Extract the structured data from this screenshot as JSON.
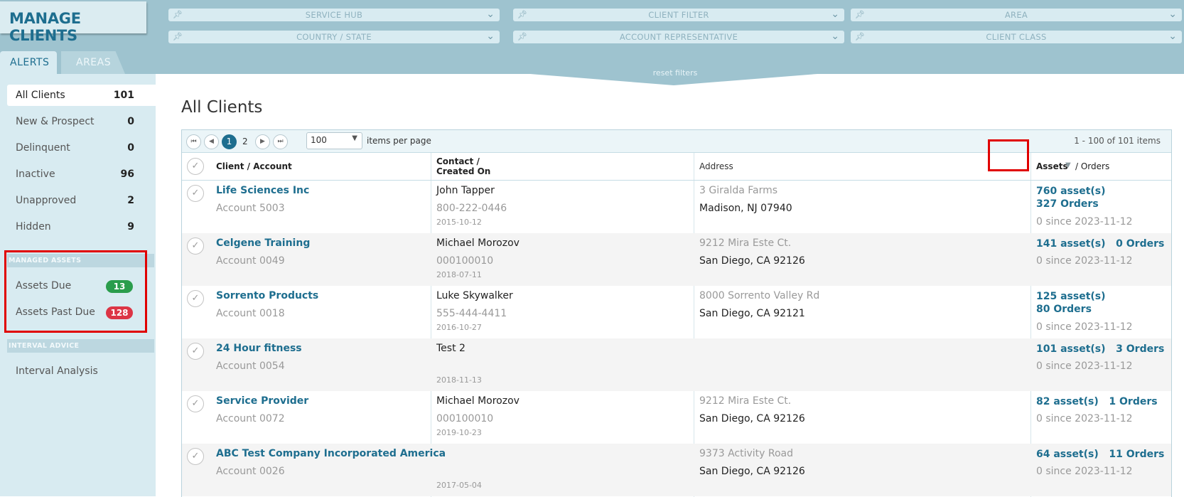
{
  "header": {
    "title": "MANAGE CLIENTS",
    "filters": [
      {
        "label": "SERVICE HUB"
      },
      {
        "label": "CLIENT FILTER"
      },
      {
        "label": "AREA"
      },
      {
        "label": "COUNTRY / STATE"
      },
      {
        "label": "ACCOUNT REPRESENTATIVE"
      },
      {
        "label": "CLIENT CLASS"
      }
    ],
    "reset_label": "reset filters"
  },
  "tabs": [
    {
      "label": "ALERTS",
      "active": true
    },
    {
      "label": "AREAS",
      "active": false
    }
  ],
  "sidebar": {
    "items": [
      {
        "label": "All Clients",
        "count": "101",
        "active": true
      },
      {
        "label": "New & Prospect",
        "count": "0"
      },
      {
        "label": "Delinquent",
        "count": "0"
      },
      {
        "label": "Inactive",
        "count": "96"
      },
      {
        "label": "Unapproved",
        "count": "2"
      },
      {
        "label": "Hidden",
        "count": "9"
      }
    ],
    "managed_assets": {
      "heading": "MANAGED ASSETS",
      "items": [
        {
          "label": "Assets Due",
          "count": "13",
          "color": "#2a9d4c"
        },
        {
          "label": "Assets Past Due",
          "count": "128",
          "color": "#dc3545"
        }
      ]
    },
    "interval_advice": {
      "heading": "INTERVAL ADVICE",
      "items": [
        {
          "label": "Interval Analysis"
        }
      ]
    }
  },
  "main": {
    "title": "All Clients",
    "pager": {
      "pages": [
        "1",
        "2"
      ],
      "current": "1",
      "per_page": "100",
      "per_page_label": "items per page",
      "summary": "1 - 100 of 101 items"
    },
    "columns": {
      "client": "Client / Account",
      "contact_line1": "Contact /",
      "contact_line2": "Created On",
      "address": "Address",
      "assets": "Assets",
      "orders": "/ Orders"
    },
    "rows": [
      {
        "name": "Life Sciences Inc",
        "account": "Account 5003",
        "contact": "John Tapper",
        "phone": "800-222-0446",
        "created": "2015-10-12",
        "address1": "3 Giralda Farms",
        "address2": "Madison, NJ 07940",
        "assets": "760 asset(s)   327 Orders",
        "since": "0 since 2023-11-12"
      },
      {
        "name": "Celgene Training",
        "account": "Account 0049",
        "contact": "Michael Morozov",
        "phone": "000100010",
        "created": "2018-07-11",
        "address1": "9212 Mira Este Ct.",
        "address2": "San Diego, CA 92126",
        "assets": "141 asset(s)   0 Orders",
        "since": "0 since 2023-11-12"
      },
      {
        "name": "Sorrento Products",
        "account": "Account 0018",
        "contact": "Luke Skywalker",
        "phone": "555-444-4411",
        "created": "2016-10-27",
        "address1": "8000 Sorrento Valley Rd",
        "address2": "San Diego, CA 92121",
        "assets": "125 asset(s)   80 Orders",
        "since": "0 since 2023-11-12"
      },
      {
        "name": "24 Hour fitness",
        "account": "Account 0054",
        "contact": "Test 2",
        "phone": "",
        "created": "2018-11-13",
        "address1": "",
        "address2": "",
        "assets": "101 asset(s)   3 Orders",
        "since": "0 since 2023-11-12"
      },
      {
        "name": "Service Provider",
        "account": "Account 0072",
        "contact": "Michael Morozov",
        "phone": "000100010",
        "created": "2019-10-23",
        "address1": "9212 Mira Este Ct.",
        "address2": "San Diego, CA 92126",
        "assets": "82 asset(s)   1 Orders",
        "since": "0 since 2023-11-12"
      },
      {
        "name": "ABC Test Company Incorporated America",
        "account": "Account 0026",
        "contact": "",
        "phone": "",
        "created": "2017-05-04",
        "address1": "9373 Activity Road",
        "address2": "San Diego, CA 92126",
        "assets": "64 asset(s)   11 Orders",
        "since": "0 since 2023-11-12"
      }
    ]
  }
}
